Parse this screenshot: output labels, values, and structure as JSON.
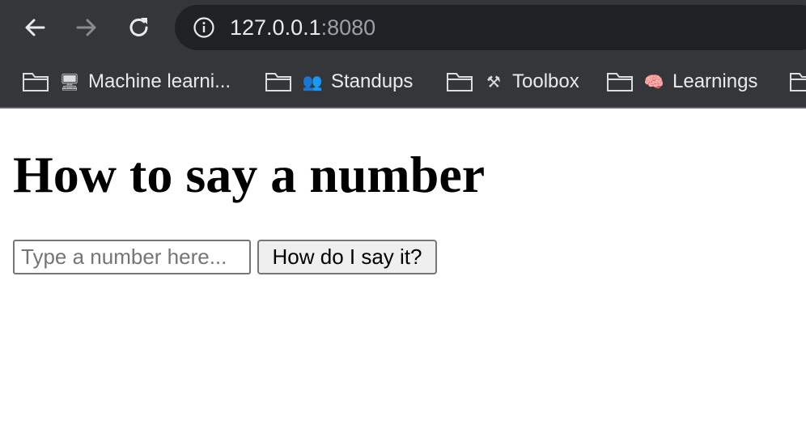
{
  "browser": {
    "address_bar": {
      "host": "127.0.0.1",
      "port": ":8080"
    },
    "nav": {
      "back_icon": "arrow-left-icon",
      "forward_icon": "arrow-right-icon",
      "reload_icon": "reload-icon",
      "info_icon": "info-icon"
    },
    "bookmarks": [
      {
        "label": "Machine learni...",
        "emoji": "🖥"
      },
      {
        "label": "Standups",
        "emoji": "👥"
      },
      {
        "label": "Toolbox",
        "emoji": "⚒"
      },
      {
        "label": "Learnings",
        "emoji": "🧠"
      }
    ],
    "colors": {
      "chrome_bg": "#35363a",
      "omnibox_bg": "#202124",
      "text": "#e8eaed"
    }
  },
  "page": {
    "title": "How to say a number",
    "input": {
      "placeholder": "Type a number here...",
      "value": ""
    },
    "button_label": "How do I say it?"
  }
}
